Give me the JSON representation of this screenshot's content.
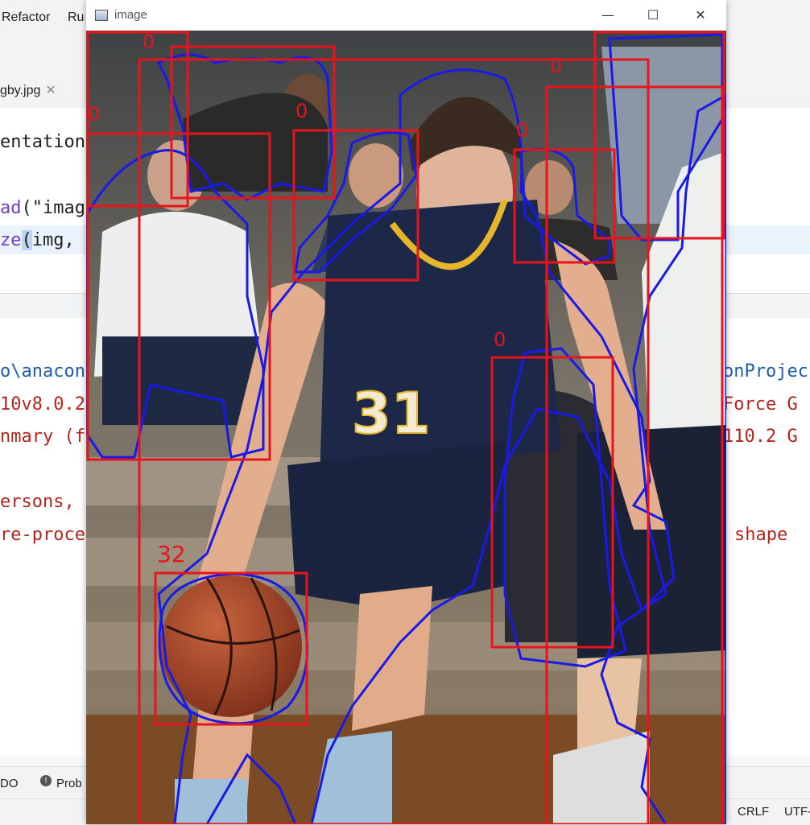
{
  "ide": {
    "menu": {
      "refactor": "Refactor",
      "run": "Ru"
    },
    "tab": {
      "file": "gby.jpg",
      "close": "✕"
    },
    "code": {
      "line1": "entation",
      "line2_func": "ad",
      "line2_rest": "(\"imag",
      "line3_func": "ze",
      "line3_sel": "(",
      "line3_rest": "img,"
    },
    "console_left": [
      "o\\anacon",
      "10v8.0.2",
      "nmary (f",
      "ersons,",
      "re-proce"
    ],
    "console_right": [
      "onProjec",
      "Force G",
      "110.2 G",
      "shape"
    ],
    "bottom_tabs": {
      "todo": "DO",
      "problems": "Prob"
    },
    "status": {
      "line_sep": "CRLF",
      "encoding": "UTF-"
    }
  },
  "window": {
    "title": "image",
    "min_glyph": "—",
    "max_glyph": "☐",
    "close_glyph": "✕"
  },
  "detections": {
    "labels": {
      "person": "0",
      "ball": "32"
    },
    "box_color": "#e8141c",
    "mask_color": "#1a1ae6"
  }
}
